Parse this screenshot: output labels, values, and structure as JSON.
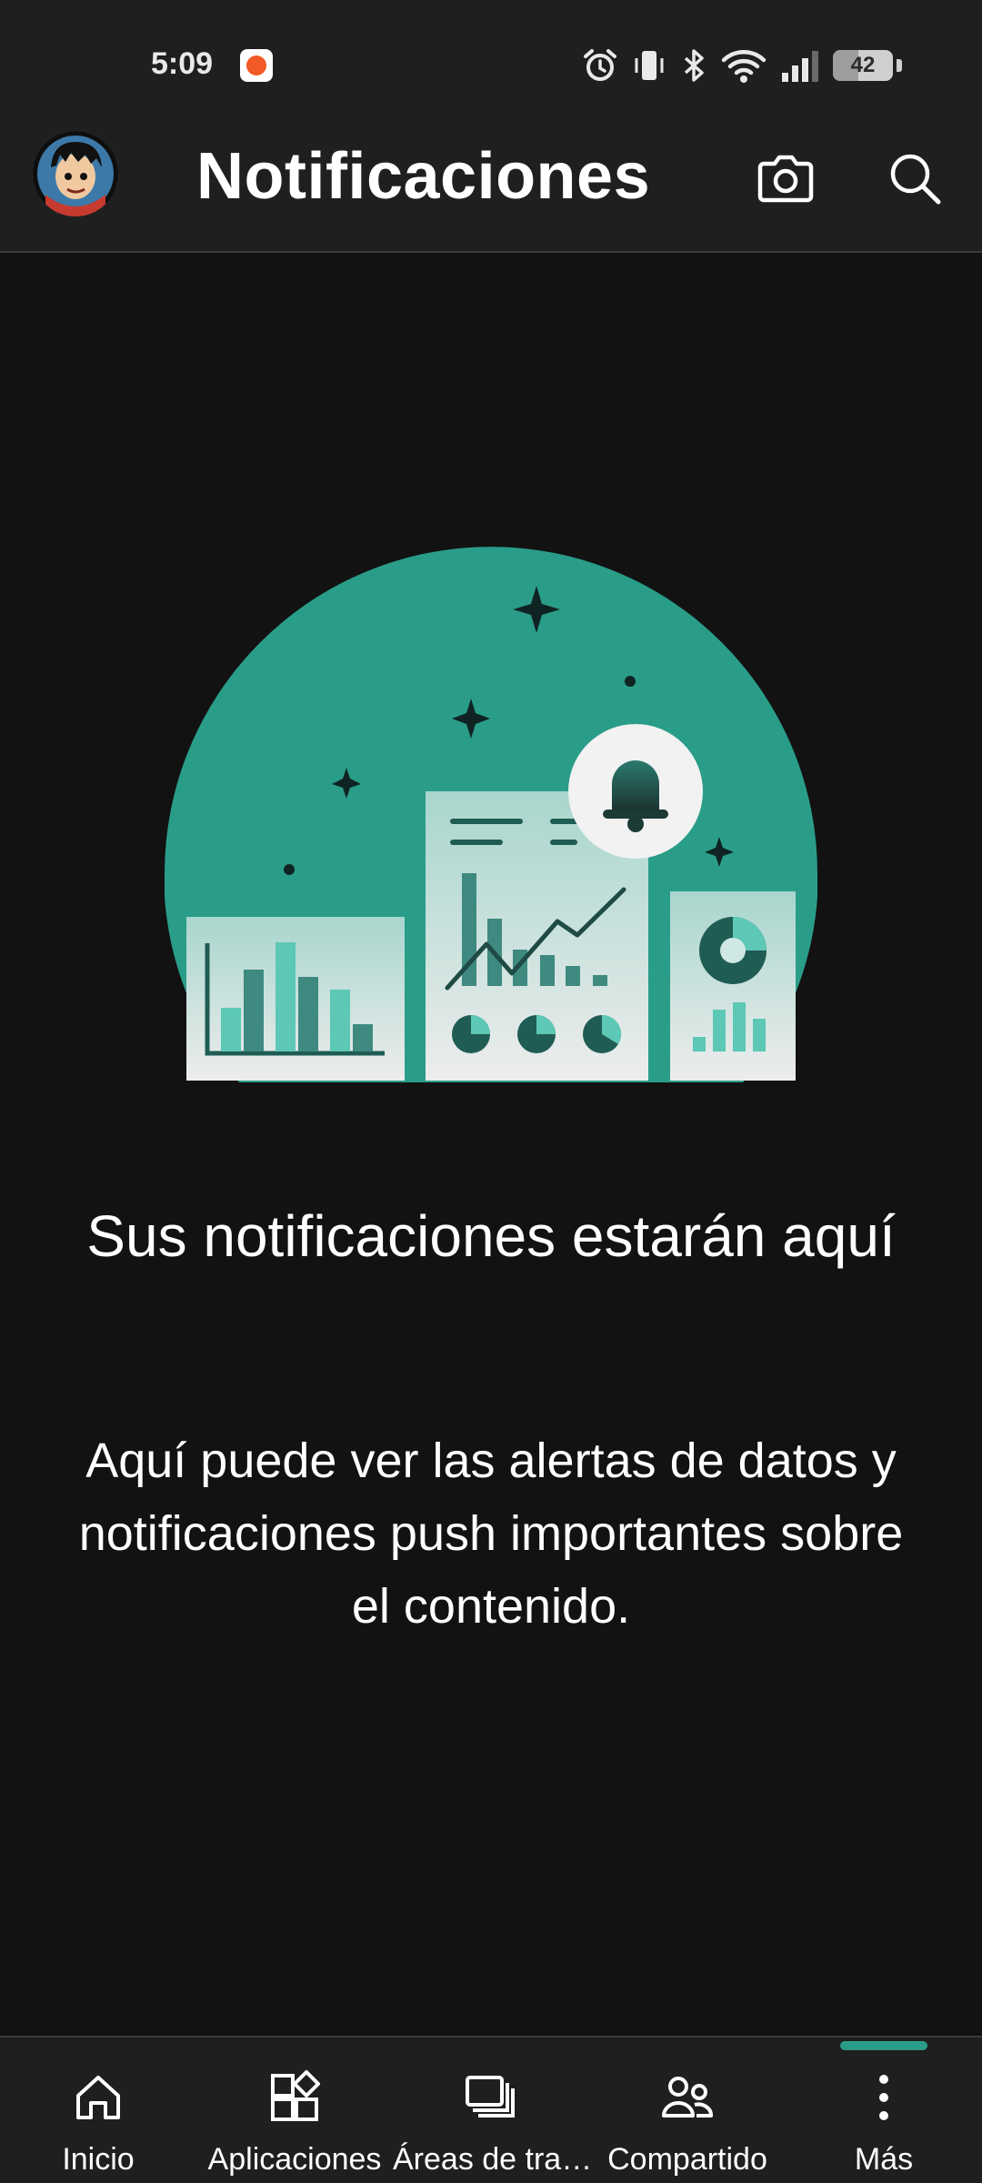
{
  "status_bar": {
    "time": "5:09",
    "battery_level": "42"
  },
  "app_bar": {
    "title": "Notificaciones"
  },
  "empty_state": {
    "title": "Sus notificaciones estarán aquí",
    "body": "Aquí puede ver las alertas de datos y notificaciones push importantes sobre el contenido."
  },
  "bottom_nav": {
    "items": [
      {
        "label": "Inicio",
        "icon": "home-icon"
      },
      {
        "label": "Aplicaciones",
        "icon": "apps-icon"
      },
      {
        "label": "Áreas de tra…",
        "icon": "workspaces-icon"
      },
      {
        "label": "Compartido",
        "icon": "shared-icon"
      },
      {
        "label": "Más",
        "icon": "more-vertical-icon"
      }
    ],
    "selected_index": 4
  },
  "colors": {
    "background": "#121212",
    "bar_background": "#1f1f1f",
    "accent": "#2a9d89"
  }
}
